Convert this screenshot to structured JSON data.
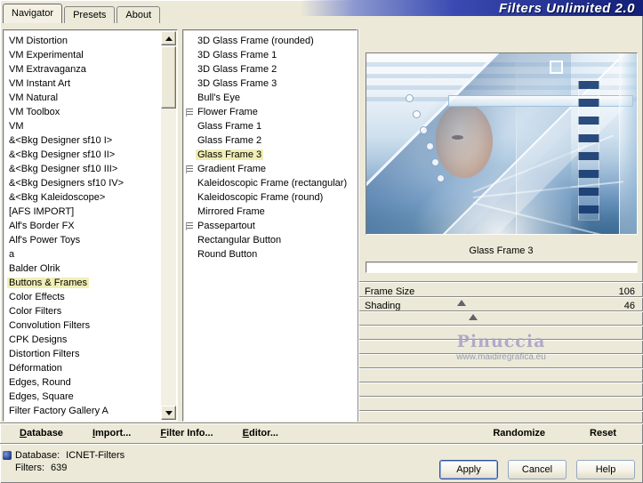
{
  "window": {
    "banner_title": "Filters Unlimited 2.0"
  },
  "tabs": [
    {
      "label": "Navigator",
      "active": true
    },
    {
      "label": "Presets",
      "active": false
    },
    {
      "label": "About",
      "active": false
    }
  ],
  "category_list": {
    "items": [
      "VM Distortion",
      "VM Experimental",
      "VM Extravaganza",
      "VM Instant Art",
      "VM Natural",
      "VM Toolbox",
      "VM",
      "&<Bkg Designer sf10 I>",
      "&<Bkg Designer sf10 II>",
      "&<Bkg Designer sf10 III>",
      "&<Bkg Designers sf10 IV>",
      "&<Bkg Kaleidoscope>",
      "[AFS IMPORT]",
      "Alf's Border FX",
      "Alf's Power Toys",
      "a",
      "Balder Olrik",
      "Buttons & Frames",
      "Color Effects",
      "Color Filters",
      "Convolution Filters",
      "CPK Designs",
      "Distortion Filters",
      "Déformation",
      "Edges, Round",
      "Edges, Square",
      "Filter Factory Gallery A"
    ],
    "selected": "Buttons & Frames"
  },
  "filter_list": {
    "items": [
      {
        "label": "3D Glass Frame (rounded)",
        "icon": false
      },
      {
        "label": "3D Glass Frame 1",
        "icon": false
      },
      {
        "label": "3D Glass Frame 2",
        "icon": false
      },
      {
        "label": "3D Glass Frame 3",
        "icon": false
      },
      {
        "label": "Bull's Eye",
        "icon": false
      },
      {
        "label": "Flower Frame",
        "icon": true
      },
      {
        "label": "Glass Frame 1",
        "icon": false
      },
      {
        "label": "Glass Frame 2",
        "icon": false
      },
      {
        "label": "Glass Frame 3",
        "icon": false
      },
      {
        "label": "Gradient Frame",
        "icon": true
      },
      {
        "label": "Kaleidoscopic Frame (rectangular)",
        "icon": false
      },
      {
        "label": "Kaleidoscopic Frame (round)",
        "icon": false
      },
      {
        "label": "Mirrored Frame",
        "icon": false
      },
      {
        "label": "Passepartout",
        "icon": true
      },
      {
        "label": "Rectangular Button",
        "icon": false
      },
      {
        "label": "Round Button",
        "icon": false
      }
    ],
    "selected": "Glass Frame 3"
  },
  "preview": {
    "caption": "Glass Frame 3"
  },
  "parameters": {
    "rows": [
      {
        "label": "Frame Size",
        "value": "106",
        "thumb_pct": 36
      },
      {
        "label": "Shading",
        "value": "46",
        "thumb_pct": 40
      }
    ],
    "empty_rows": 7
  },
  "watermark": {
    "title": "Pinuccia",
    "url": "www.maidiregrafica.eu"
  },
  "toolbar": {
    "left": [
      {
        "label": "Database",
        "underline_index": 0
      },
      {
        "label": "Import...",
        "underline_index": 0
      },
      {
        "label": "Filter Info...",
        "underline_index": 0
      },
      {
        "label": "Editor...",
        "underline_index": 0
      }
    ],
    "right": [
      {
        "label": "Randomize"
      },
      {
        "label": "Reset"
      }
    ]
  },
  "status": {
    "database_label": "Database:",
    "database_value": "ICNET-Filters",
    "filters_label": "Filters:",
    "filters_value": "639"
  },
  "action_buttons": [
    {
      "label": "Apply",
      "default": true
    },
    {
      "label": "Cancel",
      "default": false
    },
    {
      "label": "Help",
      "default": false
    }
  ],
  "colors": {
    "highlight": "#f0eeb4",
    "banner_blue": "#131f78"
  }
}
